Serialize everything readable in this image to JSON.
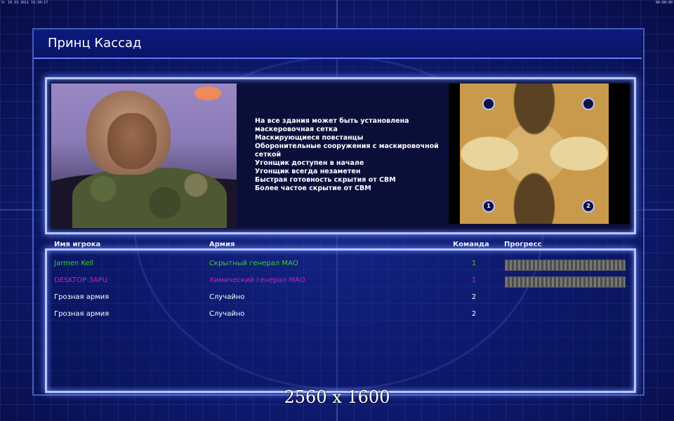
{
  "status_bar": {
    "left_text": "Ч: 19 33 2011 15:34:17",
    "right_text": "00:00:00"
  },
  "window": {
    "title": "Принц Кассад"
  },
  "general": {
    "portrait_icon": "general-portrait",
    "traits": [
      "На все здания может быть установлена",
      " маскеровочная сетка",
      "Маскирующиеся повстанцы",
      "Оборонительные сооружения с маскировочной",
      " сеткой",
      "Угонщик доступен в начале",
      "Угонщик всегда незаметен",
      "Быстрая готовность скрытия от СВМ",
      "Более частое скрытие от СВМ"
    ],
    "minimap": {
      "spawn_labels": [
        "1",
        "2"
      ]
    }
  },
  "table": {
    "headers": {
      "name": "Имя игрока",
      "army": "Армия",
      "team": "Команда",
      "progress": "Прогресс"
    },
    "rows": [
      {
        "name": "Jarmen Kell",
        "army": "Скрытный генерал МАО",
        "team": "1",
        "progress": 1.0,
        "color": "#39d039"
      },
      {
        "name": "DESKTOP-3APU",
        "army": "Химический генерал МАО",
        "team": "1",
        "progress": 1.0,
        "color": "#c424c4"
      },
      {
        "name": "Грозная армия",
        "army": "Случайно",
        "team": "2",
        "progress": null,
        "color": "#ffffff"
      },
      {
        "name": "Грозная армия",
        "army": "Случайно",
        "team": "2",
        "progress": null,
        "color": "#ffffff"
      }
    ]
  },
  "overlay_text": "2560 x 1600"
}
